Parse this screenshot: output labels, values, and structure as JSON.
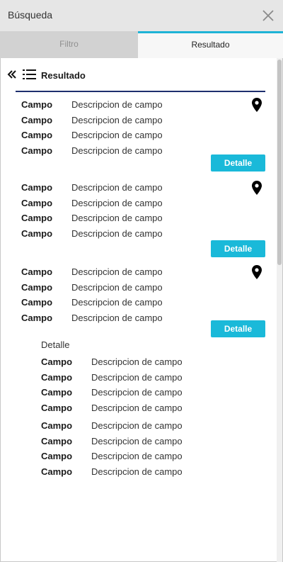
{
  "window": {
    "title": "Búsqueda",
    "close_icon": "close-icon"
  },
  "tabs": [
    {
      "label": "Filtro",
      "active": false
    },
    {
      "label": "Resultado",
      "active": true
    }
  ],
  "results": {
    "title": "Resultado",
    "accent_color": "#1e2f6e",
    "button_color": "#1ab9d9",
    "items": [
      {
        "fields": [
          {
            "key": "Campo",
            "value": "Descripcion de campo"
          },
          {
            "key": "Campo",
            "value": "Descripcion de campo"
          },
          {
            "key": "Campo",
            "value": "Descripcion de campo"
          },
          {
            "key": "Campo",
            "value": "Descripcion de campo"
          }
        ],
        "button": "Detalle",
        "icon": "map-pin-icon"
      },
      {
        "fields": [
          {
            "key": "Campo",
            "value": "Descripcion de campo"
          },
          {
            "key": "Campo",
            "value": "Descripcion de campo"
          },
          {
            "key": "Campo",
            "value": "Descripcion de campo"
          },
          {
            "key": "Campo",
            "value": "Descripcion de campo"
          }
        ],
        "button": "Detalle",
        "icon": "map-pin-icon"
      },
      {
        "fields": [
          {
            "key": "Campo",
            "value": "Descripcion de campo"
          },
          {
            "key": "Campo",
            "value": "Descripcion de campo"
          },
          {
            "key": "Campo",
            "value": "Descripcion de campo"
          },
          {
            "key": "Campo",
            "value": "Descripcion de campo"
          }
        ],
        "button": "Detalle",
        "icon": "map-pin-icon"
      }
    ],
    "detail": {
      "title": "Detalle",
      "fields": [
        {
          "key": "Campo",
          "value": "Descripcion de campo"
        },
        {
          "key": "Campo",
          "value": "Descripcion de campo"
        },
        {
          "key": "Campo",
          "value": "Descripcion de campo"
        },
        {
          "key": "Campo",
          "value": "Descripcion de campo"
        },
        {
          "key": "Campo",
          "value": "Descripcion de campo"
        },
        {
          "key": "Campo",
          "value": "Descripcion de campo"
        },
        {
          "key": "Campo",
          "value": "Descripcion de campo"
        },
        {
          "key": "Campo",
          "value": "Descripcion de campo"
        }
      ]
    }
  }
}
